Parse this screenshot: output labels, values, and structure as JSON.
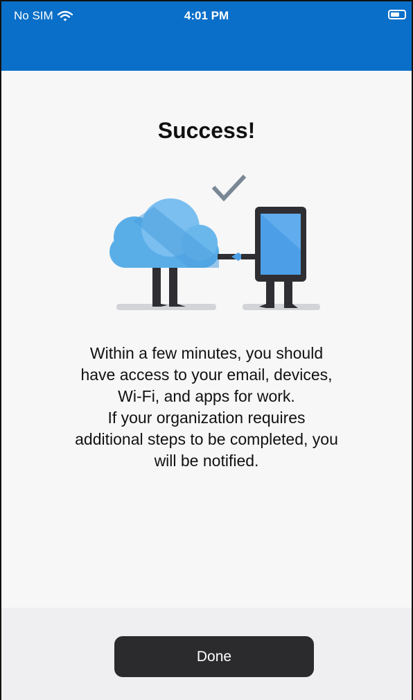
{
  "status_bar": {
    "carrier": "No SIM",
    "time": "4:01 PM",
    "icons": [
      "wifi-icon",
      "battery-icon"
    ]
  },
  "header": {
    "color": "#0a6fc8"
  },
  "main": {
    "title": "Success!",
    "illustration": "cloud-shaking-hands-with-device",
    "message": "Within a few minutes, you should\nhave access to your email, devices,\nWi-Fi, and apps for work.\nIf your organization requires\nadditional steps to be completed, you\nwill be notified."
  },
  "footer": {
    "done_label": "Done"
  },
  "colors": {
    "accent": "#0a6fc8",
    "button": "#2b2b2d",
    "cloud": "#5aaee8",
    "device_screen": "#4c9fe6",
    "check": "#7a8794"
  }
}
